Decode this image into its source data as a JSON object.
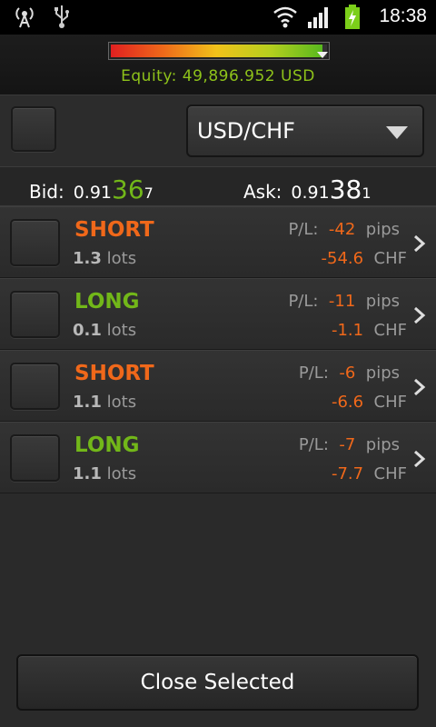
{
  "status_bar": {
    "time": "18:38",
    "icons": [
      "wireless-broadcast-icon",
      "usb-icon",
      "wifi-icon",
      "signal-icon",
      "battery-charging-icon"
    ]
  },
  "equity": {
    "text": "Equity: 49,896.952 USD",
    "level_percent": 98
  },
  "instrument": {
    "pair": "USD/CHF"
  },
  "quote": {
    "bid": {
      "label": "Bid:",
      "prefix": "0.91",
      "big": "36",
      "suffix": "7",
      "color": "#72b719"
    },
    "ask": {
      "label": "Ask:",
      "prefix": "0.91",
      "big": "38",
      "suffix": "1",
      "color": "#ffffff"
    }
  },
  "positions": [
    {
      "side": "SHORT",
      "side_type": "short",
      "lots_value": "1.3",
      "lots_unit": "lots",
      "pl_label": "P/L:",
      "pl_pips": "-42",
      "pips_unit": "pips",
      "pl_money": "-54.6",
      "currency": "CHF"
    },
    {
      "side": "LONG",
      "side_type": "long",
      "lots_value": "0.1",
      "lots_unit": "lots",
      "pl_label": "P/L:",
      "pl_pips": "-11",
      "pips_unit": "pips",
      "pl_money": "-1.1",
      "currency": "CHF"
    },
    {
      "side": "SHORT",
      "side_type": "short",
      "lots_value": "1.1",
      "lots_unit": "lots",
      "pl_label": "P/L:",
      "pl_pips": "-6",
      "pips_unit": "pips",
      "pl_money": "-6.6",
      "currency": "CHF"
    },
    {
      "side": "LONG",
      "side_type": "long",
      "lots_value": "1.1",
      "lots_unit": "lots",
      "pl_label": "P/L:",
      "pl_pips": "-7",
      "pips_unit": "pips",
      "pl_money": "-7.7",
      "currency": "CHF"
    }
  ],
  "actions": {
    "close_selected": "Close Selected"
  },
  "colors": {
    "short": "#f0681a",
    "long": "#72b719",
    "loss": "#f0681a",
    "equity_text": "#8ec21a"
  }
}
